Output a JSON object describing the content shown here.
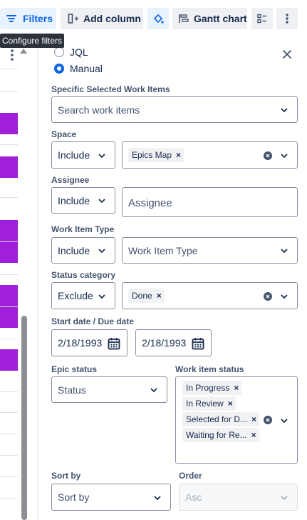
{
  "toolbar": {
    "filters_label": "Filters",
    "add_column_label": "Add column",
    "gantt_label": "Gantt chart"
  },
  "tooltip": "Configure filters",
  "mode": {
    "jql_label": "JQL",
    "manual_label": "Manual",
    "selected": "Manual"
  },
  "specific_items": {
    "label": "Specific Selected Work Items",
    "placeholder": "Search work items"
  },
  "space": {
    "label": "Space",
    "operator": "Include",
    "tags": [
      "Epics Map"
    ]
  },
  "assignee": {
    "label": "Assignee",
    "operator": "Include",
    "placeholder": "Assignee"
  },
  "work_item_type": {
    "label": "Work Item Type",
    "operator": "Include",
    "placeholder": "Work Item Type"
  },
  "status_category": {
    "label": "Status category",
    "operator": "Exclude",
    "tags": [
      "Done"
    ]
  },
  "dates": {
    "label": "Start date / Due date",
    "start": "2/18/1993",
    "due": "2/18/1993"
  },
  "epic_status": {
    "label": "Epic status",
    "placeholder": "Status"
  },
  "work_item_status": {
    "label": "Work item status",
    "tags": [
      "In Progress",
      "In Review",
      "Selected for D...",
      "Waiting for Re..."
    ]
  },
  "sort_by": {
    "label": "Sort by",
    "placeholder": "Sort by"
  },
  "order": {
    "label": "Order",
    "value": "Asc"
  },
  "colors": {
    "accent": "#0c66e4",
    "bar": "#a01fd9"
  }
}
